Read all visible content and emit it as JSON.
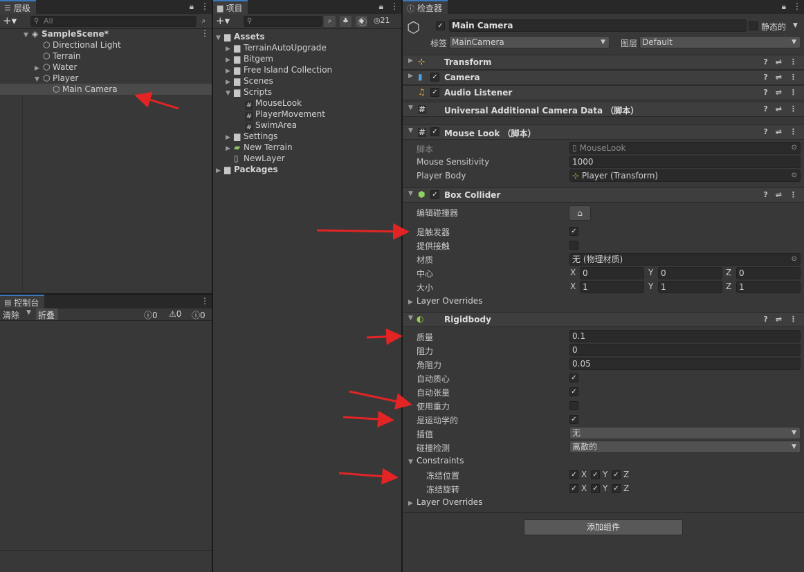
{
  "hierarchy": {
    "tab": "层级",
    "search_placeholder": "All",
    "scene": "SampleScene*",
    "items": [
      "Directional Light",
      "Terrain",
      "Water",
      "Player",
      "Main Camera"
    ]
  },
  "project": {
    "tab": "项目",
    "badge": "21",
    "assets_label": "Assets",
    "folders": [
      "TerrainAutoUpgrade",
      "Bitgem",
      "Free Island Collection",
      "Scenes",
      "Scripts"
    ],
    "scripts": [
      "MouseLook",
      "PlayerMovement",
      "SwimArea"
    ],
    "after": [
      "Settings",
      "New Terrain",
      "NewLayer"
    ],
    "packages_label": "Packages"
  },
  "console": {
    "tab": "控制台",
    "clear": "清除",
    "collapse": "折叠",
    "counts": [
      "0",
      "0",
      "0"
    ]
  },
  "inspector": {
    "tab": "检查器",
    "object_name": "Main Camera",
    "static_label": "静态的",
    "tag_label": "标签",
    "tag_value": "MainCamera",
    "layer_label": "图层",
    "layer_value": "Default",
    "components": {
      "transform": "Transform",
      "camera": "Camera",
      "audio": "Audio Listener",
      "uacd": "Universal Additional Camera Data （脚本）",
      "mouselook": "Mouse Look （脚本）",
      "boxcollider": "Box Collider",
      "rigidbody": "Rigidbody"
    },
    "mouselook": {
      "script_label": "脚本",
      "script_value": "MouseLook",
      "sens_label": "Mouse Sensitivity",
      "sens_value": "1000",
      "body_label": "Player Body",
      "body_value": "Player (Transform)"
    },
    "boxcollider": {
      "edit_label": "编辑碰撞器",
      "trigger_label": "是触发器",
      "contacts_label": "提供接触",
      "material_label": "材质",
      "material_value": "无 (物理材质)",
      "center_label": "中心",
      "size_label": "大小",
      "center": {
        "x": "0",
        "y": "0",
        "z": "0"
      },
      "size": {
        "x": "1",
        "y": "1",
        "z": "1"
      },
      "layer_overrides": "Layer Overrides"
    },
    "rigidbody": {
      "mass_label": "质量",
      "mass": "0.1",
      "drag_label": "阻力",
      "drag": "0",
      "angdrag_label": "角阻力",
      "angdrag": "0.05",
      "automass_label": "自动质心",
      "autotensor_label": "自动张量",
      "gravity_label": "使用重力",
      "kinematic_label": "是运动学的",
      "interp_label": "插值",
      "interp_value": "无",
      "collision_label": "碰撞检测",
      "collision_value": "离散的",
      "constraints_label": "Constraints",
      "freeze_pos_label": "冻结位置",
      "freeze_rot_label": "冻结旋转",
      "axes": {
        "x": "X",
        "y": "Y",
        "z": "Z"
      },
      "layer_overrides": "Layer Overrides"
    },
    "add_component": "添加组件"
  },
  "colors": {
    "accent": "#3a79bb",
    "annotation": "#e32424"
  }
}
